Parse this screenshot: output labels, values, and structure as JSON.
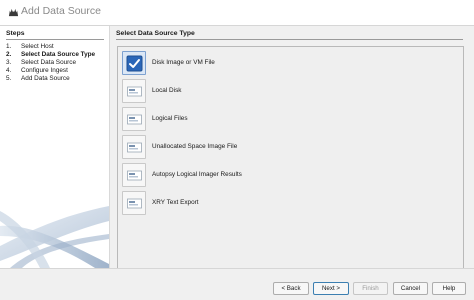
{
  "window": {
    "title": "Add Data Source",
    "icon": "autopsy-dog-icon"
  },
  "steps": {
    "header": "Steps",
    "items": [
      {
        "num": "1.",
        "label": "Select Host",
        "active": false
      },
      {
        "num": "2.",
        "label": "Select Data Source Type",
        "active": true
      },
      {
        "num": "3.",
        "label": "Select Data Source",
        "active": false
      },
      {
        "num": "4.",
        "label": "Configure Ingest",
        "active": false
      },
      {
        "num": "5.",
        "label": "Add Data Source",
        "active": false
      }
    ]
  },
  "main": {
    "header": "Select Data Source Type",
    "types": [
      {
        "label": "Disk Image or VM File",
        "selected": true,
        "icon": "checkbox-icon"
      },
      {
        "label": "Local Disk",
        "selected": false,
        "icon": "local-disk-icon"
      },
      {
        "label": "Logical Files",
        "selected": false,
        "icon": "logical-files-icon"
      },
      {
        "label": "Unallocated Space Image File",
        "selected": false,
        "icon": "unallocated-image-icon"
      },
      {
        "label": "Autopsy Logical Imager Results",
        "selected": false,
        "icon": "logical-imager-icon"
      },
      {
        "label": "XRY Text Export",
        "selected": false,
        "icon": "xry-export-icon"
      }
    ]
  },
  "footer": {
    "back_label": "< Back",
    "next_label": "Next >",
    "finish_label": "Finish",
    "cancel_label": "Cancel",
    "help_label": "Help"
  },
  "colors": {
    "accent": "#3c7fb1",
    "checkbox_blue": "#2a66b8"
  }
}
